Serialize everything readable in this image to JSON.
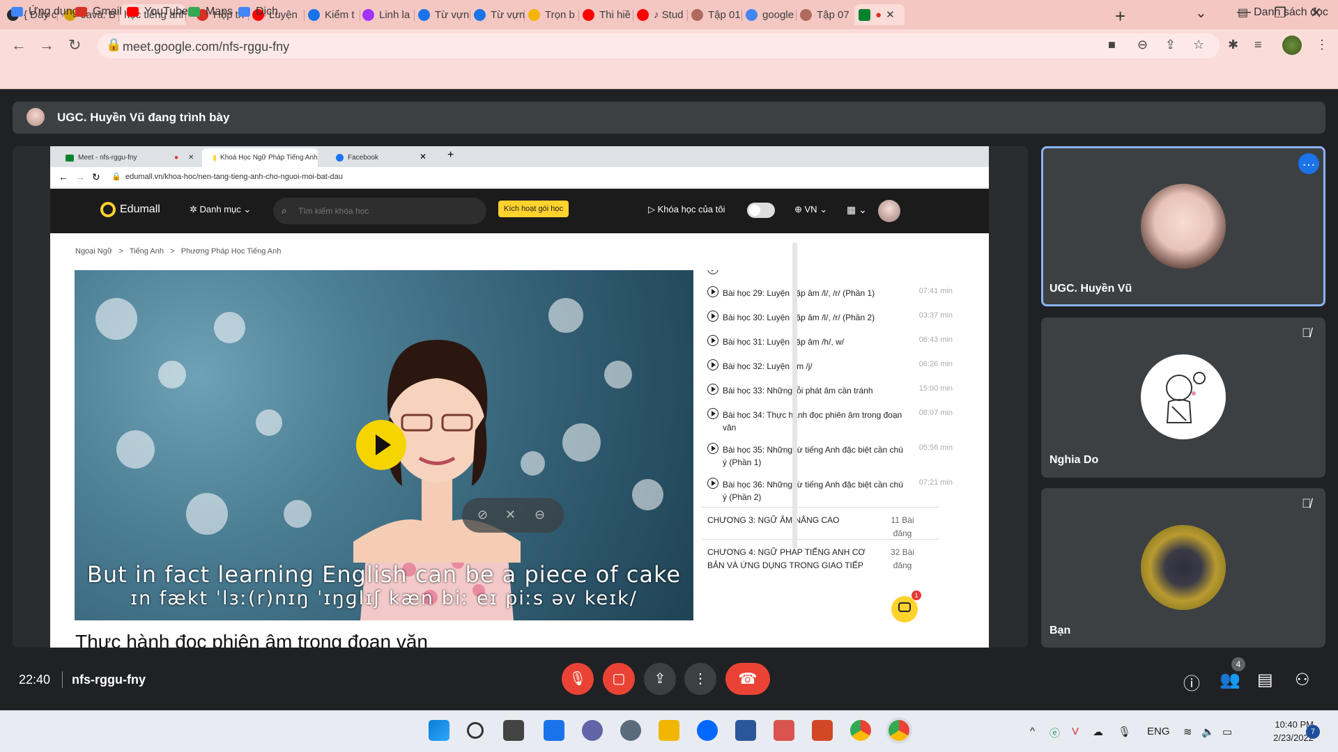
{
  "browser": {
    "tabs": [
      {
        "label": "{ Đây c",
        "icon": "github-icon",
        "color": "#24292e"
      },
      {
        "label": "Java: B",
        "icon": "v1-icon",
        "color": "#d4a000"
      },
      {
        "label": "học tiếng anh",
        "icon": "none",
        "color": "#5f6368",
        "active": true
      },
      {
        "label": "Hộp th",
        "icon": "gmail-icon",
        "color": "#d93025"
      },
      {
        "label": "Luyện",
        "icon": "youtube-icon",
        "color": "#ff0000"
      },
      {
        "label": "Kiểm t",
        "icon": "quiz-icon",
        "color": "#1a73e8"
      },
      {
        "label": "Linh la",
        "icon": "messenger-icon",
        "color": "#a033ff"
      },
      {
        "label": "Từ vựn",
        "icon": "quiz-icon",
        "color": "#1a73e8"
      },
      {
        "label": "Từ vựn",
        "icon": "quiz-icon",
        "color": "#1a73e8"
      },
      {
        "label": "Trọn b",
        "icon": "edumall-icon",
        "color": "#f4b400"
      },
      {
        "label": "Thi hiề",
        "icon": "youtube-icon",
        "color": "#ff0000"
      },
      {
        "label": "♪ Stud",
        "icon": "youtube-icon",
        "color": "#ff0000"
      },
      {
        "label": "Tập 01",
        "icon": "film-icon",
        "color": "#b06a5e"
      },
      {
        "label": "google",
        "icon": "google-icon",
        "color": "#4285f4"
      },
      {
        "label": "Tập 07",
        "icon": "film-icon",
        "color": "#b06a5e"
      }
    ],
    "url": "meet.google.com/nfs-rggu-fny",
    "bookmarks": [
      {
        "label": "Ứng dụng",
        "icon": "apps-grid-icon",
        "color": "#4285f4"
      },
      {
        "label": "Gmail",
        "icon": "gmail-icon",
        "color": "#d93025"
      },
      {
        "label": "YouTube",
        "icon": "youtube-icon",
        "color": "#ff0000"
      },
      {
        "label": "Maps",
        "icon": "maps-icon",
        "color": "#34a853"
      },
      {
        "label": "Dịch",
        "icon": "translate-icon",
        "color": "#4285f4"
      }
    ],
    "reading_list": "Danh sách đọc"
  },
  "meet": {
    "presenter_text": "UGC. Huyền Vũ đang trình bày",
    "time": "22:40",
    "meeting_code": "nfs-rggu-fny",
    "participant_count": "4",
    "participants": [
      {
        "name": "UGC. Huyền Vũ",
        "muted": false,
        "active": true
      },
      {
        "name": "Nghia Do",
        "muted": true,
        "active": false
      },
      {
        "name": "Bạn",
        "muted": true,
        "active": false
      }
    ]
  },
  "shared": {
    "tabs": [
      "Meet - nfs-rggu-fny",
      "Khoá Học Ngữ Pháp Tiếng Anh T",
      "Facebook"
    ],
    "url": "edumall.vn/khoa-hoc/nen-tang-tieng-anh-cho-nguoi-moi-bat-dau",
    "site": {
      "logo": "Edumall",
      "menu": "Danh mục",
      "search_placeholder": "Tìm kiếm khóa học",
      "activate": "Kích hoạt gói học",
      "my_courses": "Khóa học của tôi",
      "lang": "VN"
    },
    "breadcrumb": [
      "Ngoại Ngữ",
      "Tiếng Anh",
      "Phương Pháp Học Tiếng Anh"
    ],
    "subtitle_line1": "But in fact learning English can be a piece of cake",
    "subtitle_line2": "ɪn fækt ˈlɜː(r)nɪŋ ˈɪŋɡlɪʃ kæn biː eɪ piːs əv keɪk/",
    "lesson_title": "Thực hành đọc phiên âm trong đoạn văn",
    "lessons": [
      {
        "title": "Bài học 29: Luyện cặp âm /l/, /r/ (Phần 1)",
        "duration": "07:41 min"
      },
      {
        "title": "Bài học 30: Luyện cặp âm /l/, /r/ (Phần 2)",
        "duration": "03:37 min"
      },
      {
        "title": "Bài học 31: Luyện cặp âm /h/, w/",
        "duration": "06:43 min"
      },
      {
        "title": "Bài học 32: Luyện âm /j/",
        "duration": "06:26 min"
      },
      {
        "title": "Bài học 33: Những lỗi phát âm cần tránh",
        "duration": "15:00 min"
      },
      {
        "title": "Bài học 34: Thực hành đọc phiên âm trong đoạn văn",
        "duration": "08:07 min"
      },
      {
        "title": "Bài học 35: Những từ tiếng Anh đặc biệt cần chú ý (Phần 1)",
        "duration": "05:56 min"
      },
      {
        "title": "Bài học 36: Những từ tiếng Anh đặc biệt cần chú ý (Phần 2)",
        "duration": "07:21 min"
      }
    ],
    "chapters": [
      {
        "title": "CHƯƠNG 3: NGỮ ÂM NÂNG CAO",
        "count": "11 Bài đăng"
      },
      {
        "title": "CHƯƠNG 4: NGỮ PHÁP TIẾNG ANH CƠ BẢN VÀ ỨNG DỤNG TRONG GIAO TIẾP",
        "count": "32 Bài đăng"
      }
    ],
    "chat_badge": "1"
  },
  "taskbar": {
    "lang": "ENG",
    "time": "10:40 PM",
    "date": "2/23/2022",
    "notifications": "7"
  }
}
